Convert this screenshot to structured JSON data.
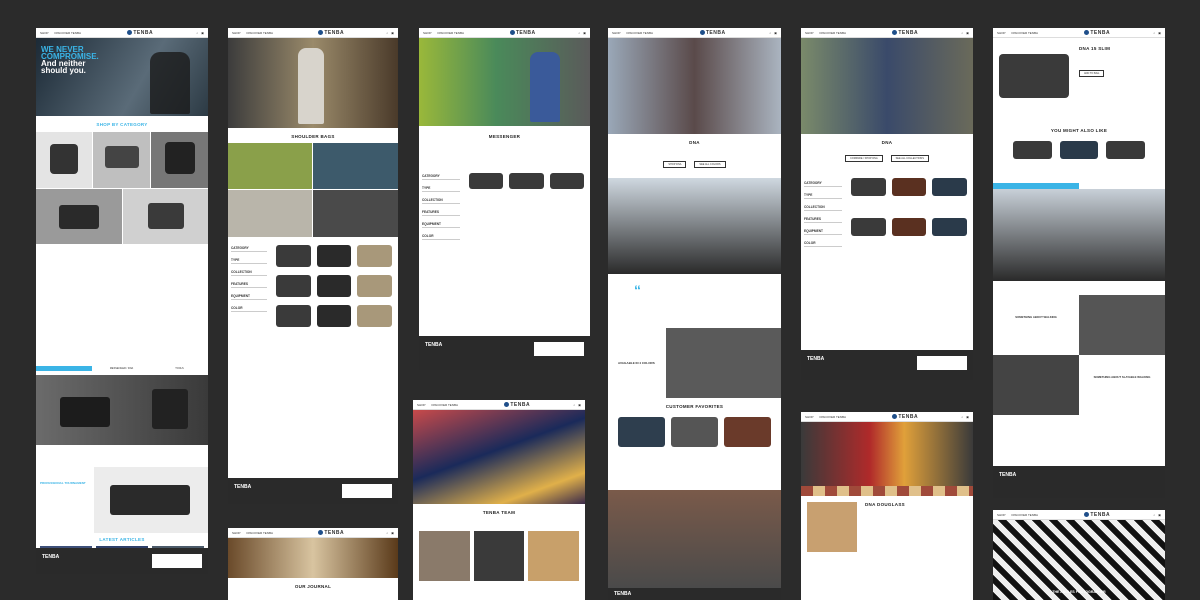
{
  "brand": {
    "logo": "TENBA",
    "accent": "#3ab4e6",
    "footer_bg": "#2a2a2a"
  },
  "nav": {
    "links": [
      "SHOP",
      "DISCOVER TENBA"
    ],
    "icons": [
      "search-icon",
      "cart-icon"
    ]
  },
  "page1": {
    "hero_line1": "WE NEVER",
    "hero_line2": "COMPROMISE.",
    "hero_line3": "And neither",
    "hero_line4": "should you.",
    "shop_by": "SHOP BY CATEGORY",
    "tabs": [
      "",
      "MESSENGER / DNA",
      "TOOLS"
    ],
    "pro": "PROFESSIONAL TOURNAMENT",
    "latest": "LATEST ARTICLES"
  },
  "page2": {
    "title": "SHOULDER BAGS",
    "cats": [
      "CATEGORY",
      "TYPE",
      "COLLECTION",
      "FEATURES",
      "EQUIPMENT",
      "COLOR"
    ]
  },
  "page2b": {
    "title": "OUR JOURNAL"
  },
  "page3": {
    "title": "MESSENGER",
    "cats": [
      "CATEGORY",
      "TYPE",
      "COLLECTION",
      "FEATURES",
      "EQUIPMENT",
      "COLOR"
    ]
  },
  "page3b": {
    "title": "TENBA TEAM"
  },
  "page4": {
    "title": "DNA",
    "colors": "AVAILABLE IN 4 COLORS",
    "favorites": "CUSTOMER FAVORITES",
    "buttons": [
      "SHOP DNA",
      "SEE ALL COLORS"
    ]
  },
  "page5": {
    "title": "DNA",
    "buttons": [
      "COMPARE / SHOP DNA",
      "SEE ALL COLLECTIONS"
    ],
    "cats": [
      "CATEGORY",
      "TYPE",
      "COLLECTION",
      "FEATURES",
      "EQUIPMENT",
      "COLOR"
    ]
  },
  "page5b": {
    "title": "DNA DOUGLASS"
  },
  "page6": {
    "title": "DNA 15 SLIM",
    "also": "YOU MIGHT ALSO LIKE",
    "cta": "ADD TO BAG",
    "feat1": "SOMETHING ABOUT WALKING",
    "feat2": "SOMETHING ABOUT SLAYABLE WALKING"
  },
  "page6b": {
    "caption": "THE ANGLES PHOTOGRAPHER"
  }
}
